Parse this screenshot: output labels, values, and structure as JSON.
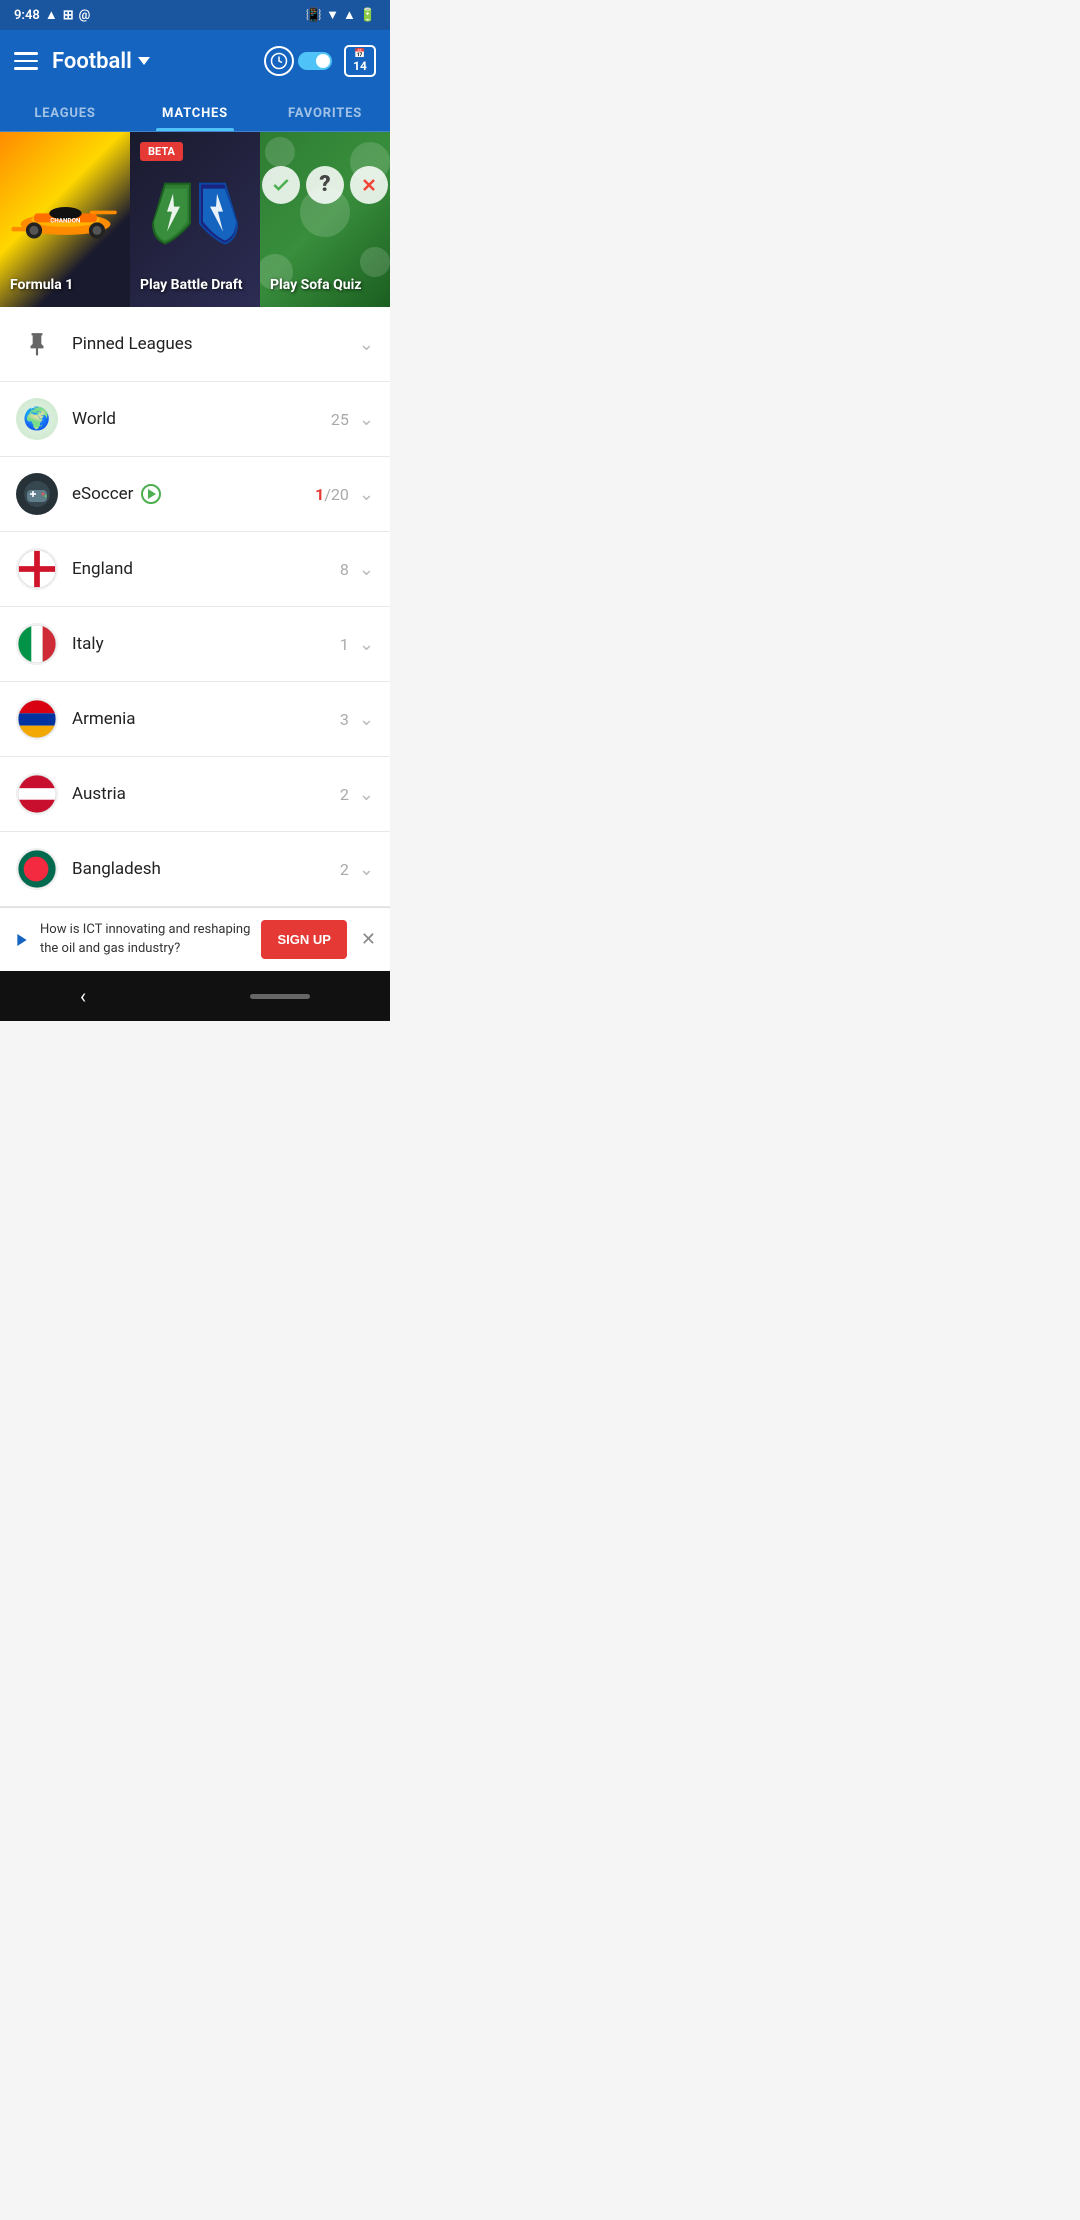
{
  "statusBar": {
    "time": "9:48",
    "icons": [
      "drive",
      "image",
      "at"
    ]
  },
  "header": {
    "title": "Football",
    "dropdownLabel": "Football dropdown",
    "calendarDay": "14"
  },
  "tabs": [
    {
      "id": "leagues",
      "label": "LEAGUES",
      "active": false
    },
    {
      "id": "matches",
      "label": "MATCHES",
      "active": true
    },
    {
      "id": "favorites",
      "label": "FAVORITES",
      "active": false
    }
  ],
  "promoCards": [
    {
      "id": "formula1",
      "label": "Formula 1",
      "badge": null
    },
    {
      "id": "battle-draft",
      "label": "Play Battle Draft",
      "badge": "BETA"
    },
    {
      "id": "sofa-quiz",
      "label": "Play Sofa Quiz",
      "badge": null
    }
  ],
  "listItems": [
    {
      "id": "pinned",
      "name": "Pinned Leagues",
      "count": "",
      "icon": "pin"
    },
    {
      "id": "world",
      "name": "World",
      "count": "25",
      "icon": "world"
    },
    {
      "id": "esoccer",
      "name": "eSoccer",
      "count": "1/20",
      "liveCount": "1",
      "totalCount": "/20",
      "icon": "esoccer",
      "hasLive": true
    },
    {
      "id": "england",
      "name": "England",
      "count": "8",
      "icon": "england"
    },
    {
      "id": "italy",
      "name": "Italy",
      "count": "1",
      "icon": "italy"
    },
    {
      "id": "armenia",
      "name": "Armenia",
      "count": "3",
      "icon": "armenia"
    },
    {
      "id": "austria",
      "name": "Austria",
      "count": "2",
      "icon": "austria"
    },
    {
      "id": "bangladesh",
      "name": "Bangladesh",
      "count": "2",
      "icon": "bangladesh"
    }
  ],
  "ad": {
    "text": "How is ICT innovating and reshaping the oil and gas industry?",
    "buttonLabel": "SIGN UP"
  },
  "bottomBar": {
    "backLabel": "‹"
  }
}
